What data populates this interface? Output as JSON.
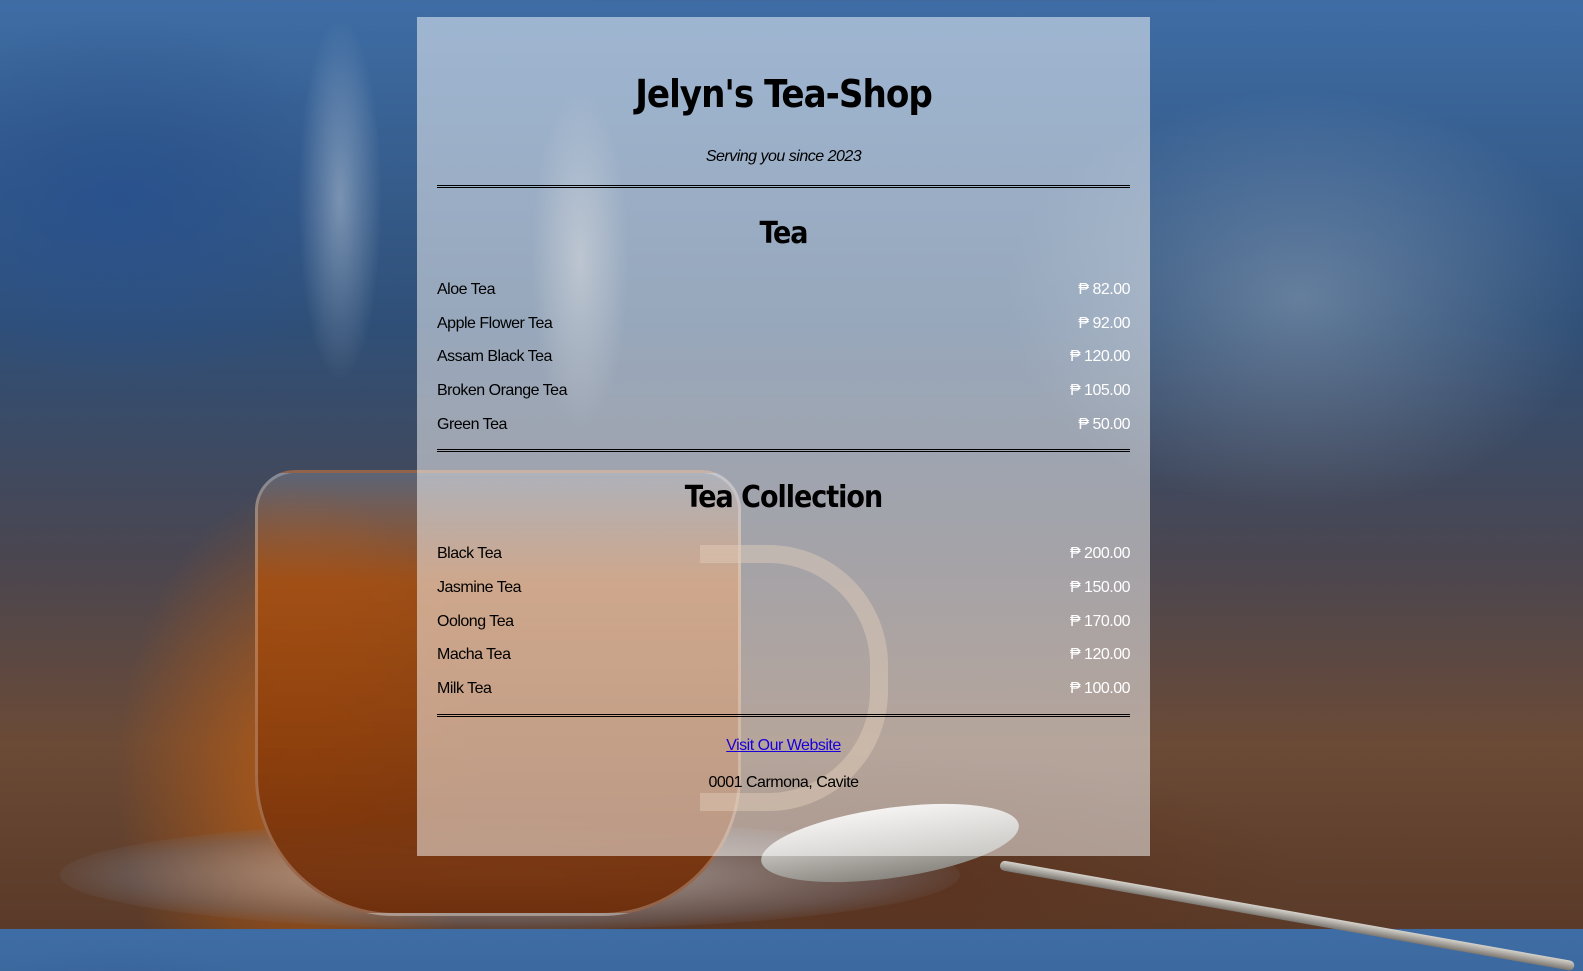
{
  "header": {
    "title": "Jelyn's Tea-Shop",
    "subtitle": "Serving you since 2023"
  },
  "sections": [
    {
      "title": "Tea",
      "items": [
        {
          "name": "Aloe Tea",
          "price": "₱ 82.00"
        },
        {
          "name": "Apple Flower Tea",
          "price": "₱ 92.00"
        },
        {
          "name": "Assam Black Tea",
          "price": "₱ 120.00"
        },
        {
          "name": "Broken Orange Tea",
          "price": "₱ 105.00"
        },
        {
          "name": "Green Tea",
          "price": "₱ 50.00"
        }
      ]
    },
    {
      "title": "Tea Collection",
      "items": [
        {
          "name": "Black Tea",
          "price": "₱ 200.00"
        },
        {
          "name": "Jasmine Tea",
          "price": "₱ 150.00"
        },
        {
          "name": "Oolong Tea",
          "price": "₱ 170.00"
        },
        {
          "name": "Macha Tea",
          "price": "₱ 120.00"
        },
        {
          "name": "Milk Tea",
          "price": "₱ 100.00"
        }
      ]
    }
  ],
  "footer": {
    "link_label": "Visit Our Website",
    "address": "0001 Carmona, Cavite"
  },
  "colors": {
    "link": "#1a00d8",
    "price": "#ffffff",
    "panel": "rgba(255,255,255,0.5)"
  }
}
